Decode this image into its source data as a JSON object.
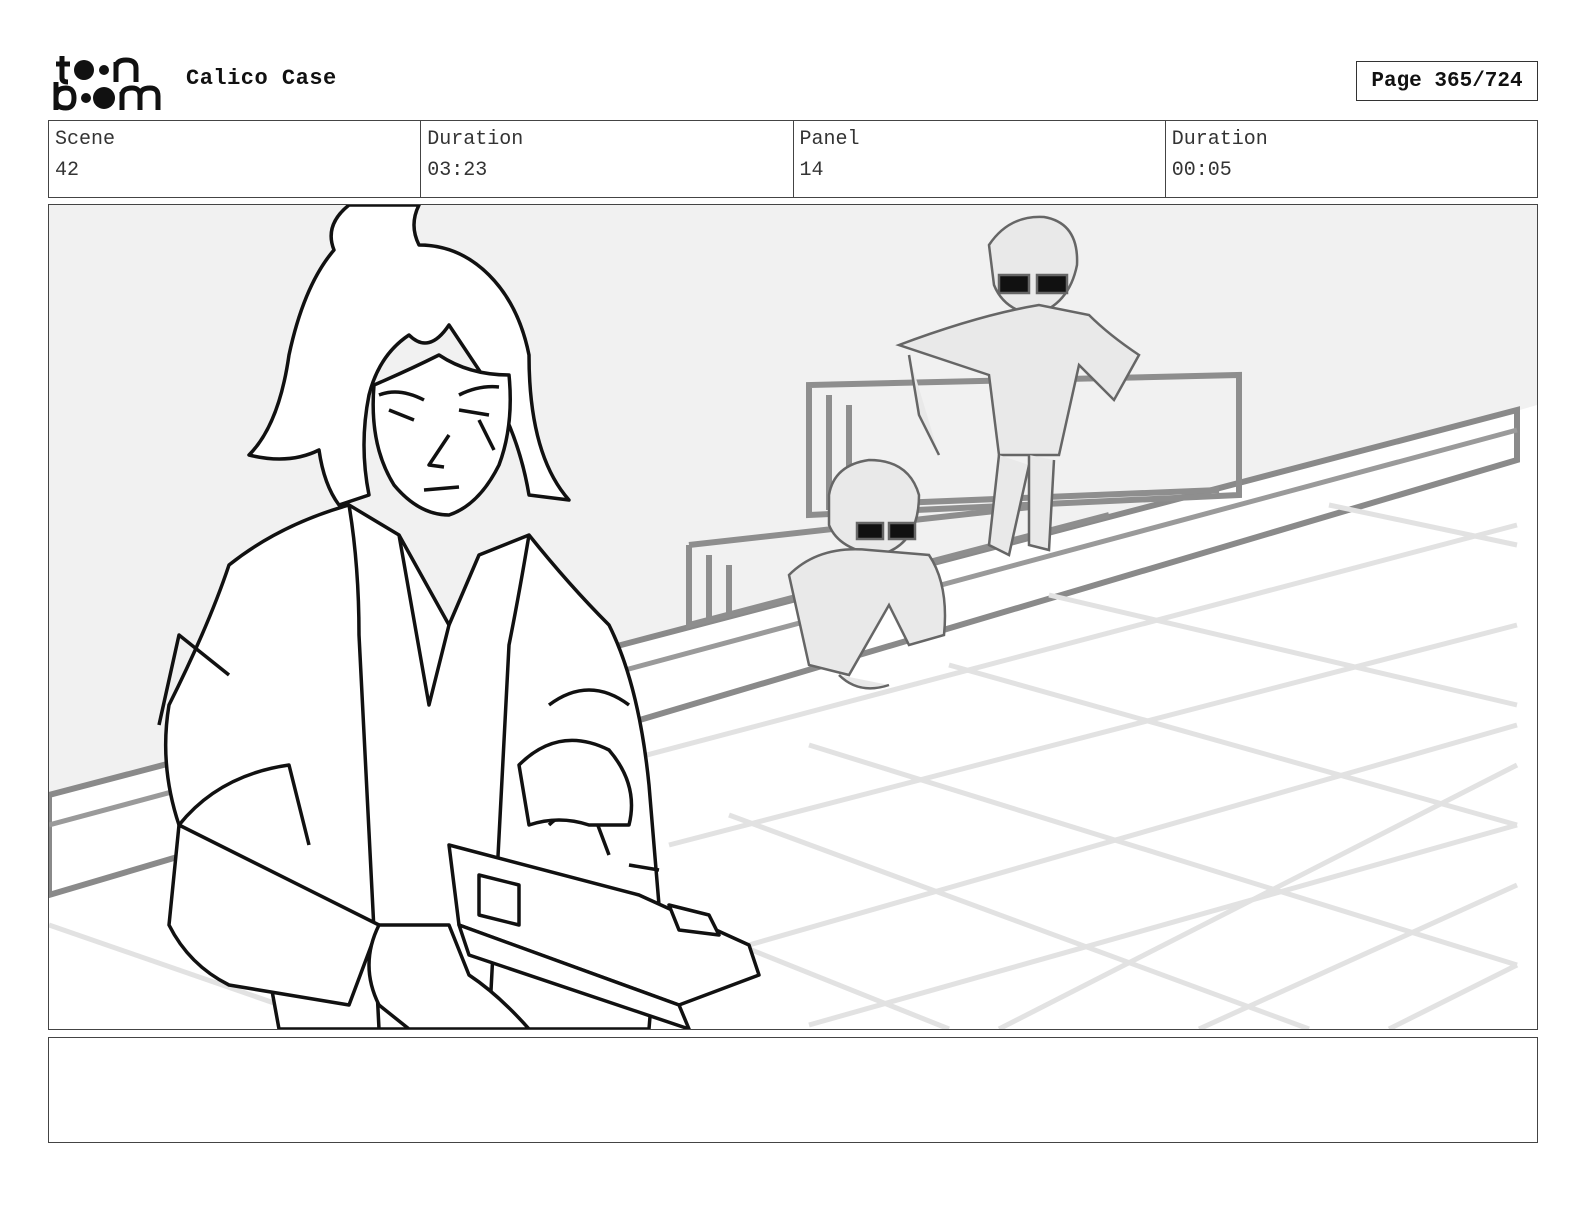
{
  "header": {
    "logo_text_top": "toon",
    "logo_text_bottom": "boom",
    "project_title": "Calico Case",
    "page_label": "Page 365/724"
  },
  "info": {
    "scene_label": "Scene",
    "scene_value": "42",
    "scene_duration_label": "Duration",
    "scene_duration_value": "03:23",
    "panel_label": "Panel",
    "panel_value": "14",
    "panel_duration_label": "Duration",
    "panel_duration_value": "00:05"
  },
  "notes": {
    "text": ""
  }
}
